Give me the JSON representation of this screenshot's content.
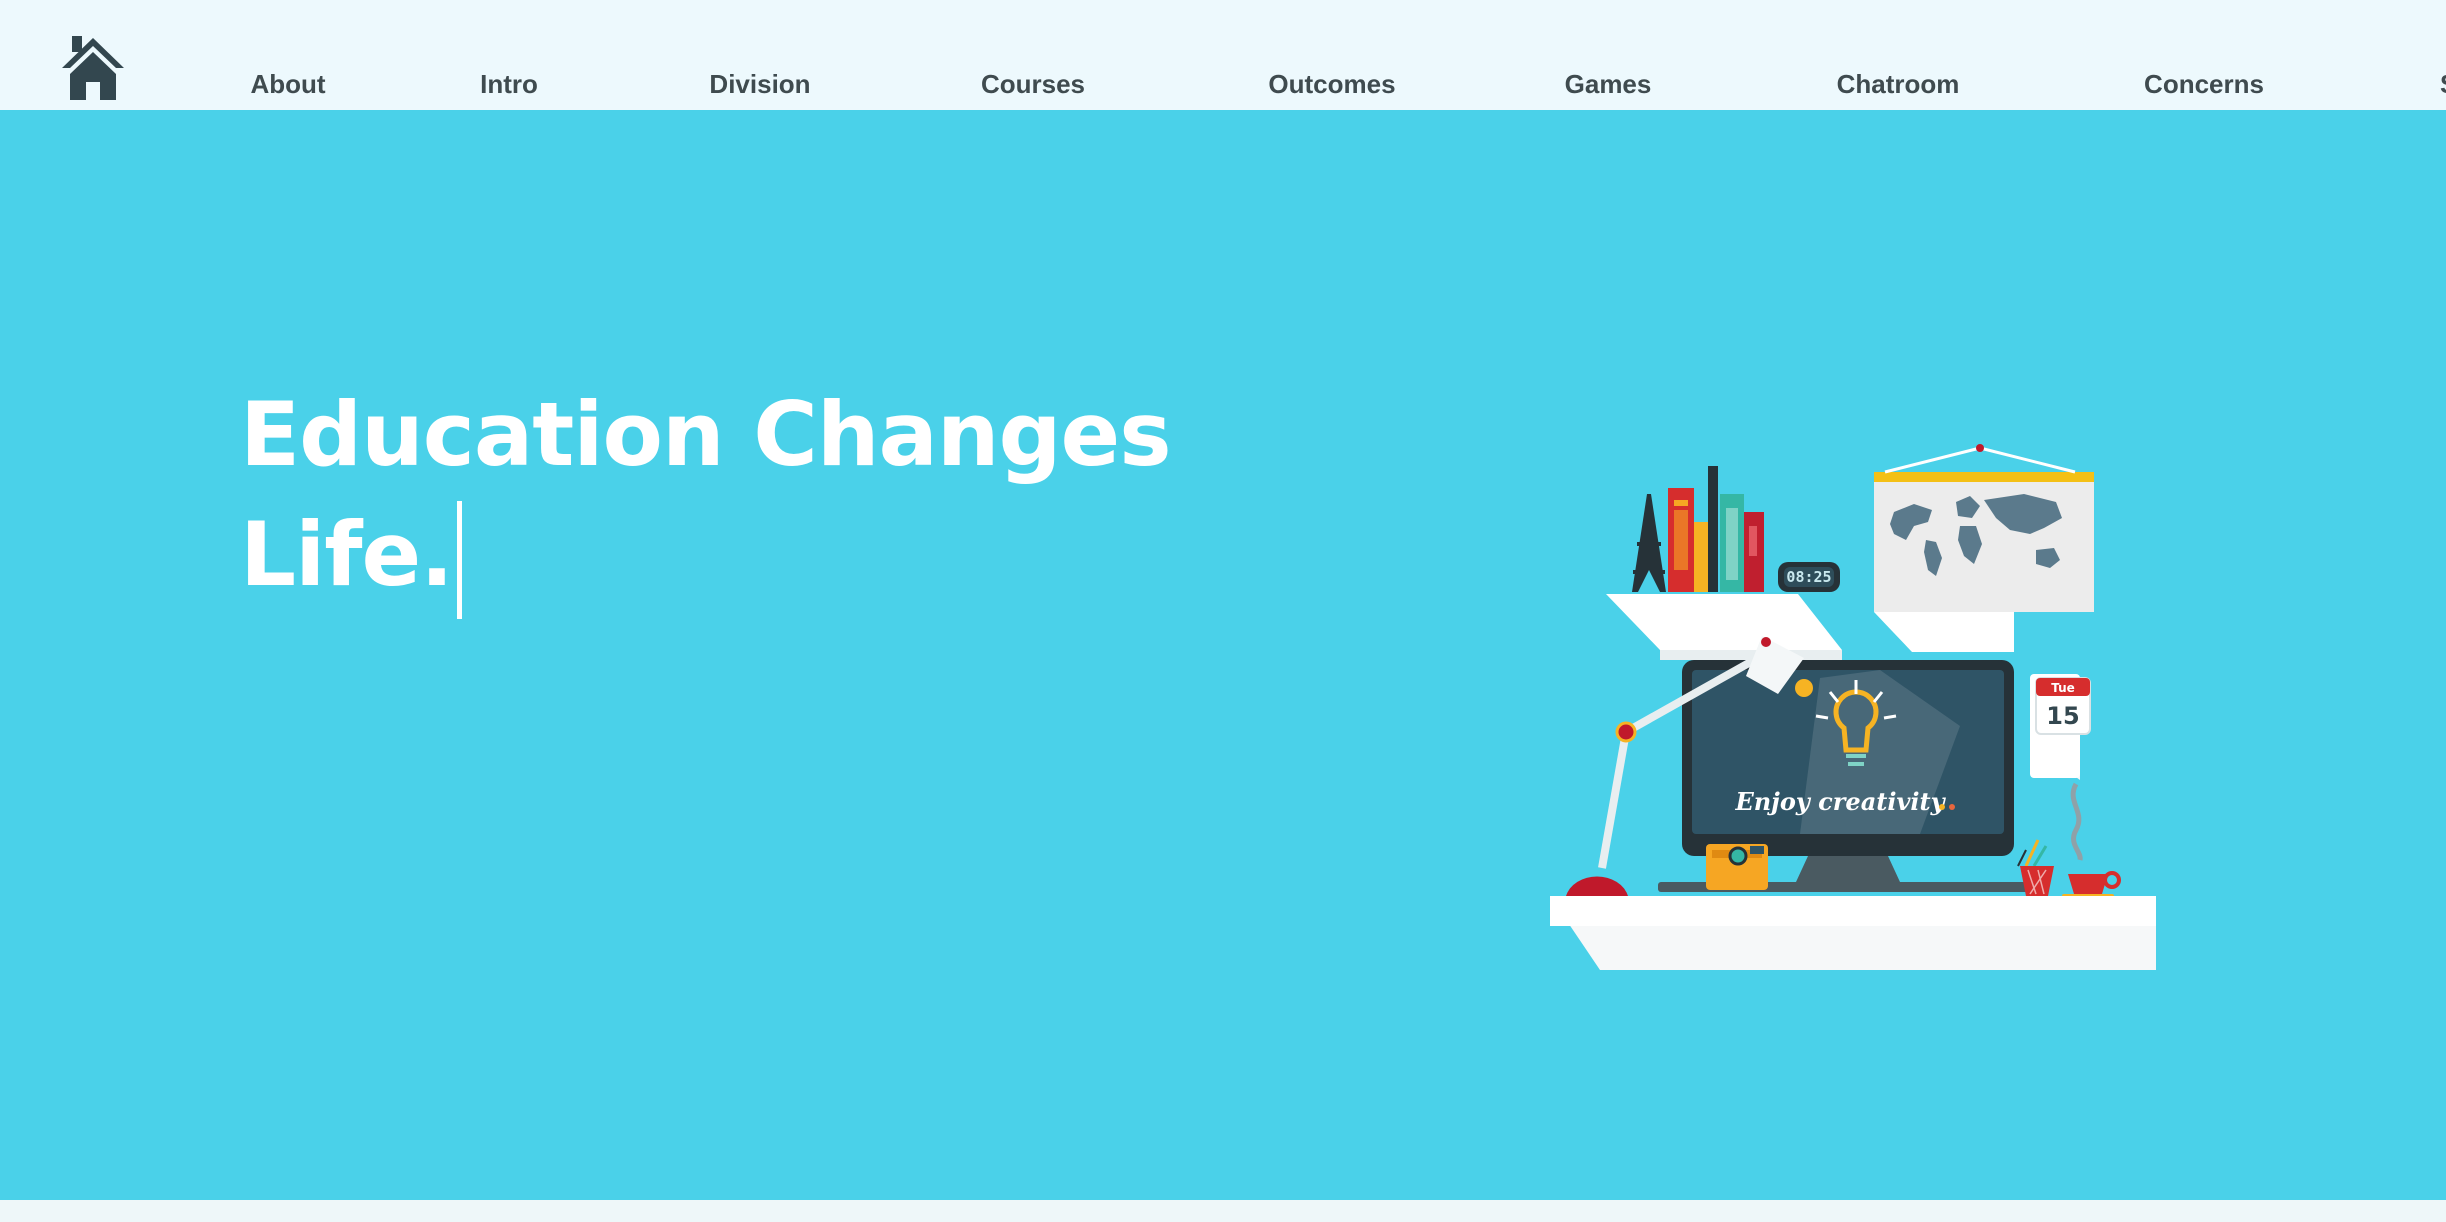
{
  "nav": {
    "home_icon": "home-icon",
    "items": [
      {
        "label": "About"
      },
      {
        "label": "Intro"
      },
      {
        "label": "Division"
      },
      {
        "label": "Courses"
      },
      {
        "label": "Outcomes"
      },
      {
        "label": "Games"
      },
      {
        "label": "Chatroom"
      },
      {
        "label": "Concerns"
      },
      {
        "label": "S"
      }
    ]
  },
  "hero": {
    "title_line1": "Education Changes",
    "title_line2": "Life."
  },
  "illustration": {
    "clock_text": "08:25",
    "calendar_day": "Tue",
    "calendar_date": "15",
    "screen_text": "Enjoy creativity"
  },
  "colors": {
    "nav_bg": "#edf9fd",
    "hero_bg": "#4ad1e9",
    "nav_text": "#3f4b4f",
    "title_text": "#ffffff"
  }
}
